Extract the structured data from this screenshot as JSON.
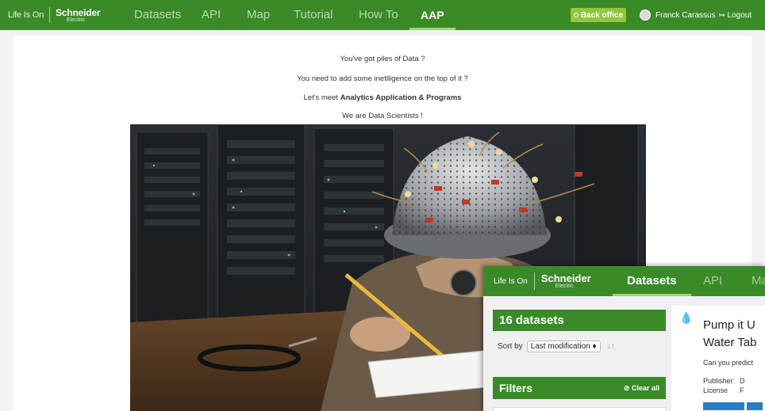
{
  "brand": {
    "tagline": "Life Is On",
    "name": "Schneider",
    "sub": "Electric"
  },
  "nav": {
    "items": [
      "Datasets",
      "API",
      "Map",
      "Tutorial",
      "How To",
      "AAP"
    ],
    "active": "AAP"
  },
  "header": {
    "back_office": "Back office",
    "user_name": "Franck Carassus",
    "logout": "Logout"
  },
  "intro": {
    "line1": "You've got piles of Data ?",
    "line2": "You need to add some inetlligence on the top of it ?",
    "line3_prefix": "Let's meet ",
    "line3_bold": "Analytics Application & Programs",
    "line4": "We are Data Scientists !"
  },
  "photo": {
    "subject": "person-with-colander-headset-in-server-room"
  },
  "inset": {
    "brand": {
      "tagline": "Life Is On",
      "name": "Schneider",
      "sub": "Electric"
    },
    "nav": [
      "Datasets",
      "API",
      "Ma"
    ],
    "dataset_count": "16 datasets",
    "sort_label": "Sort by",
    "sort_value": "Last modification",
    "filters_title": "Filters",
    "clear_all": "Clear all",
    "card": {
      "title_line1": "Pump it U",
      "title_line2": "Water Tab",
      "description": "Can you predict",
      "publisher_label": "Publisher",
      "publisher_value": "D",
      "license_label": "License",
      "license_value": "F"
    }
  },
  "colors": {
    "brand_green": "#3a8a27",
    "accent_green": "#92c63b",
    "active_underline": "#9fd27c"
  }
}
